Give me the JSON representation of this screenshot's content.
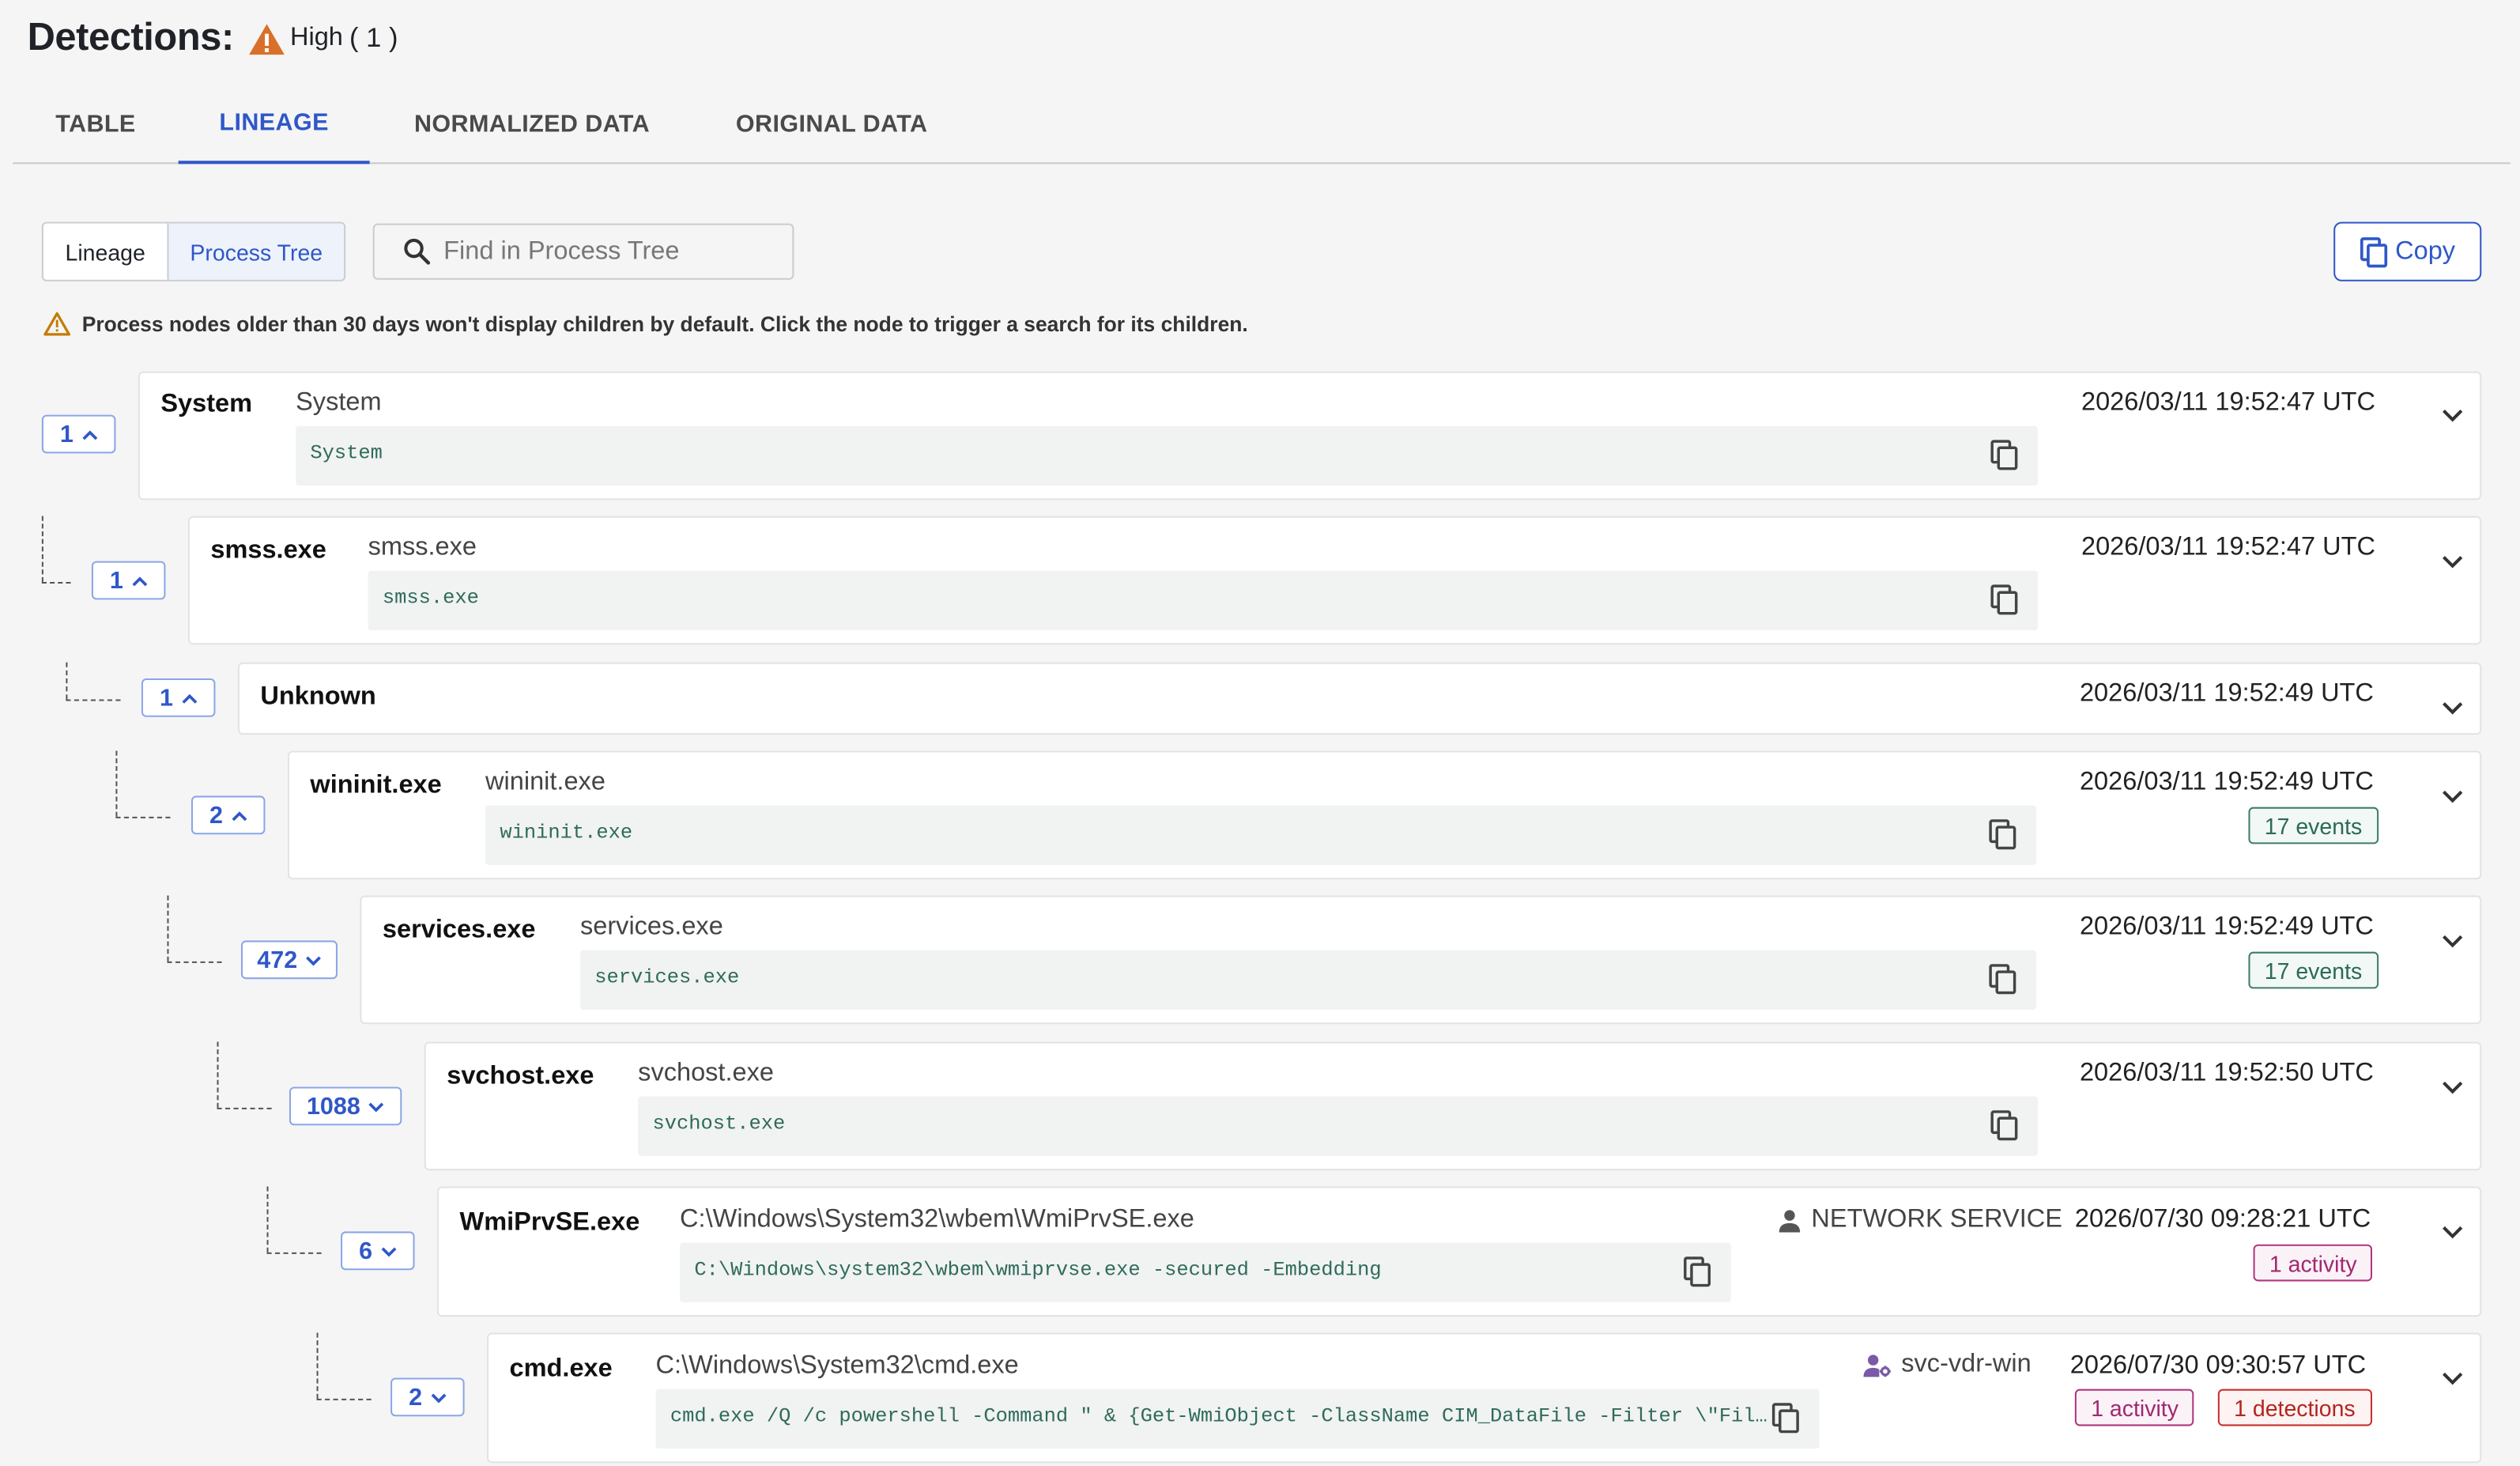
{
  "header": {
    "title": "Detections:",
    "severity": "High",
    "count": "( 1 )",
    "warning_color": "#d9702a"
  },
  "tabs": [
    {
      "label": "TABLE",
      "active": false
    },
    {
      "label": "LINEAGE",
      "active": true
    },
    {
      "label": "NORMALIZED DATA",
      "active": false
    },
    {
      "label": "ORIGINAL DATA",
      "active": false
    }
  ],
  "view_toggle": {
    "lineage": "Lineage",
    "process_tree": "Process Tree",
    "selected": "Process Tree"
  },
  "search": {
    "placeholder": "Find in Process Tree",
    "value": ""
  },
  "copy_button": {
    "label": "Copy"
  },
  "notice": "Process nodes older than 30 days won't display children by default. Click the node to trigger a search for its children.",
  "nodes": [
    {
      "count": "1",
      "expanded": true,
      "name": "System",
      "path": "System",
      "cmd": "System",
      "user": "",
      "user_icon": "",
      "timestamp": "2026/03/11 19:52:47 UTC",
      "badges": []
    },
    {
      "count": "1",
      "expanded": true,
      "name": "smss.exe",
      "path": "smss.exe",
      "cmd": "smss.exe",
      "user": "",
      "user_icon": "",
      "timestamp": "2026/03/11 19:52:47 UTC",
      "badges": []
    },
    {
      "count": "1",
      "expanded": true,
      "name": "Unknown",
      "path": "",
      "cmd": "",
      "user": "",
      "user_icon": "",
      "timestamp": "2026/03/11 19:52:49 UTC",
      "badges": []
    },
    {
      "count": "2",
      "expanded": true,
      "name": "wininit.exe",
      "path": "wininit.exe",
      "cmd": "wininit.exe",
      "user": "",
      "user_icon": "",
      "timestamp": "2026/03/11 19:52:49 UTC",
      "badges": [
        {
          "label": "17 events",
          "kind": "events"
        }
      ]
    },
    {
      "count": "472",
      "expanded": false,
      "name": "services.exe",
      "path": "services.exe",
      "cmd": "services.exe",
      "user": "",
      "user_icon": "",
      "timestamp": "2026/03/11 19:52:49 UTC",
      "badges": [
        {
          "label": "17 events",
          "kind": "events"
        }
      ]
    },
    {
      "count": "1088",
      "expanded": false,
      "name": "svchost.exe",
      "path": "svchost.exe",
      "cmd": "svchost.exe",
      "user": "",
      "user_icon": "",
      "timestamp": "2026/03/11 19:52:50 UTC",
      "badges": []
    },
    {
      "count": "6",
      "expanded": false,
      "name": "WmiPrvSE.exe",
      "path": "C:\\Windows\\System32\\wbem\\WmiPrvSE.exe",
      "cmd": "C:\\Windows\\system32\\wbem\\wmiprvse.exe -secured -Embedding",
      "user": "NETWORK SERVICE",
      "user_icon": "person-icon",
      "timestamp": "2026/07/30 09:28:21 UTC",
      "badges": [
        {
          "label": "1 activity",
          "kind": "activity"
        }
      ]
    },
    {
      "count": "2",
      "expanded": false,
      "name": "cmd.exe",
      "path": "C:\\Windows\\System32\\cmd.exe",
      "cmd": "cmd.exe /Q /c powershell -Command \" & {Get-WmiObject -ClassName CIM_DataFile -Filter \\\"Fil…",
      "user": "svc-vdr-win",
      "user_icon": "service-account-icon",
      "timestamp": "2026/07/30 09:30:57 UTC",
      "badges": [
        {
          "label": "1 activity",
          "kind": "activity"
        },
        {
          "label": "1 detections",
          "kind": "detections"
        }
      ]
    }
  ]
}
